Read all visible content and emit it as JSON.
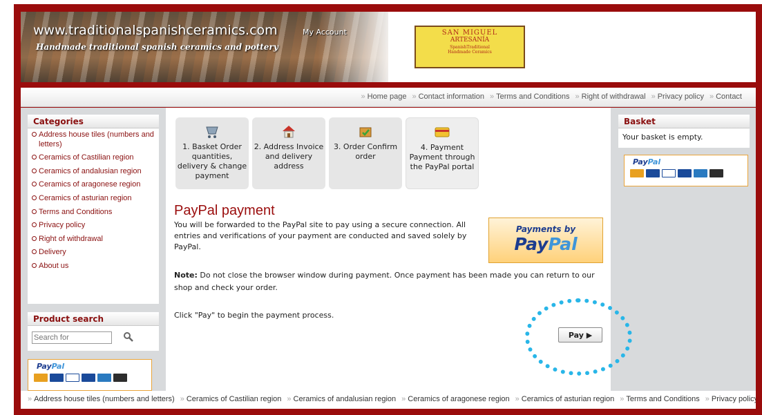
{
  "header": {
    "site_url": "www.traditionalspanishceramics.com",
    "tagline": "Handmade traditional spanish ceramics and pottery",
    "my_account": "My Account",
    "logo": {
      "title": "SAN MIGUEL",
      "subtitle": "ARTESANÍA",
      "line1": "SpanishTraditional",
      "line2": "Handmade Ceramics"
    }
  },
  "topnav": [
    "Home page",
    "Contact information",
    "Terms and Conditions",
    "Right of withdrawal",
    "Privacy policy",
    "Contact"
  ],
  "categories": {
    "title": "Categories",
    "items": [
      "Address house tiles (numbers and letters)",
      "Ceramics of Castilian region",
      "Ceramics of andalusian region",
      "Ceramics of aragonese region",
      "Ceramics of asturian region",
      "Terms and Conditions",
      "Privacy policy",
      "Right of withdrawal",
      "Delivery",
      "About us"
    ]
  },
  "search": {
    "title": "Product search",
    "placeholder": "Search for"
  },
  "paypal_logo": {
    "word_a": "Pay",
    "word_b": "Pal",
    "card_colors": [
      "#e8a020",
      "#1a4a9a",
      "#ffffff",
      "#1a4a9a",
      "#2a7ac0",
      "#2d2d2d"
    ]
  },
  "steps": [
    {
      "label": "1. Basket Order quantities, delivery & change payment",
      "icon": "basket-icon"
    },
    {
      "label": "2. Address Invoice and delivery address",
      "icon": "house-icon"
    },
    {
      "label": "3. Order Confirm order",
      "icon": "order-box-icon"
    },
    {
      "label": "4. Payment Payment through the PayPal portal",
      "icon": "payment-card-icon"
    }
  ],
  "payment": {
    "title": "PayPal payment",
    "intro": "You will be forwarded to the PayPal site to pay using a secure connection. All entries and verifications of your payment are conducted and saved solely by PayPal.",
    "note_label": "Note:",
    "note_text": " Do not close the browser window during payment. Once payment has been made you can return to our shop and check your order.",
    "click_text": "Click \"Pay\" to begin the payment process.",
    "badge_line1": "Payments by",
    "badge_word_a": "Pay",
    "badge_word_b": "Pal",
    "pay_button": "Pay ▶",
    "highlight_color": "#29b6e8"
  },
  "basket": {
    "title": "Basket",
    "empty_text": "Your basket is empty."
  },
  "bottomnav": [
    "Address house tiles (numbers and letters)",
    "Ceramics of Castilian region",
    "Ceramics of andalusian region",
    "Ceramics of aragonese region",
    "Ceramics of asturian region",
    "Terms and Conditions",
    "Privacy policy"
  ],
  "colors": {
    "frame": "#9a0c0c",
    "accent_text": "#8a1010",
    "paypal_blue": "#1c3c8f",
    "paypal_light_blue": "#3f95d9"
  }
}
